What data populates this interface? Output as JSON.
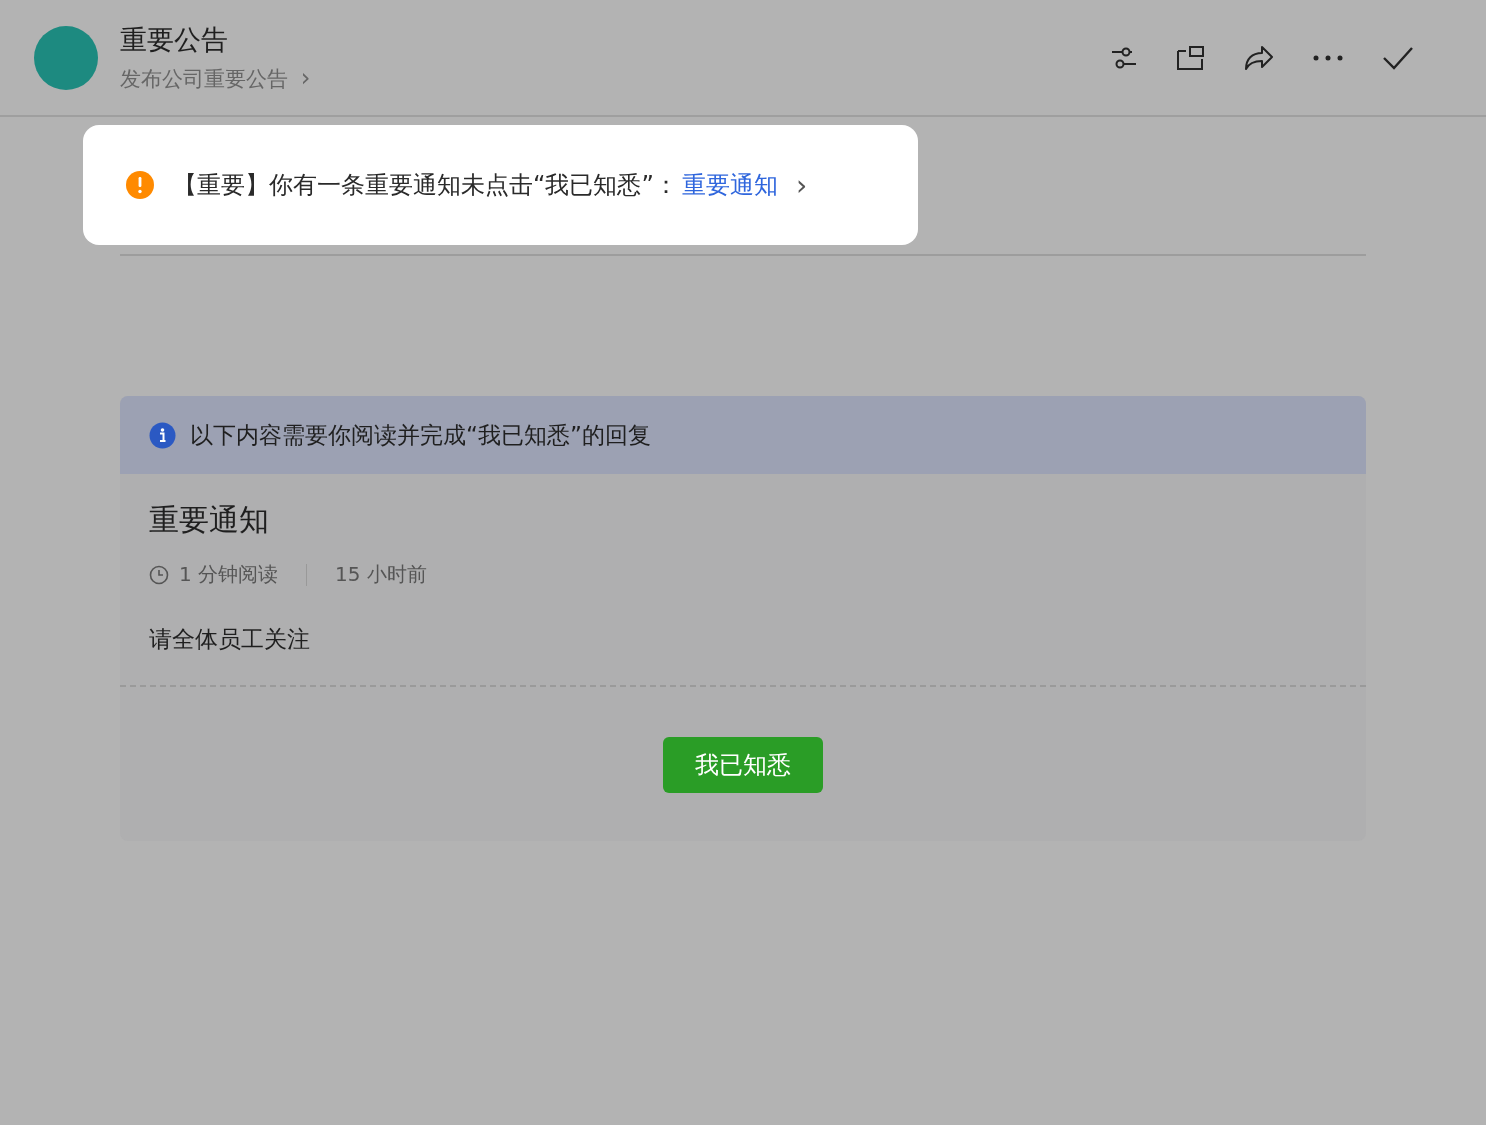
{
  "header": {
    "title": "重要公告",
    "subtitle": "发布公司重要公告",
    "subtitle_chevron": "›"
  },
  "toast": {
    "message": "【重要】你有一条重要通知未点击“我已知悉”：",
    "link": "重要通知",
    "chevron": "›"
  },
  "card": {
    "notice": "以下内容需要你阅读并完成“我已知悉”的回复",
    "title": "重要通知",
    "read_time": "1 分钟阅读",
    "posted": "15 小时前",
    "body": "请全体员工关注",
    "button": "我已知悉"
  }
}
